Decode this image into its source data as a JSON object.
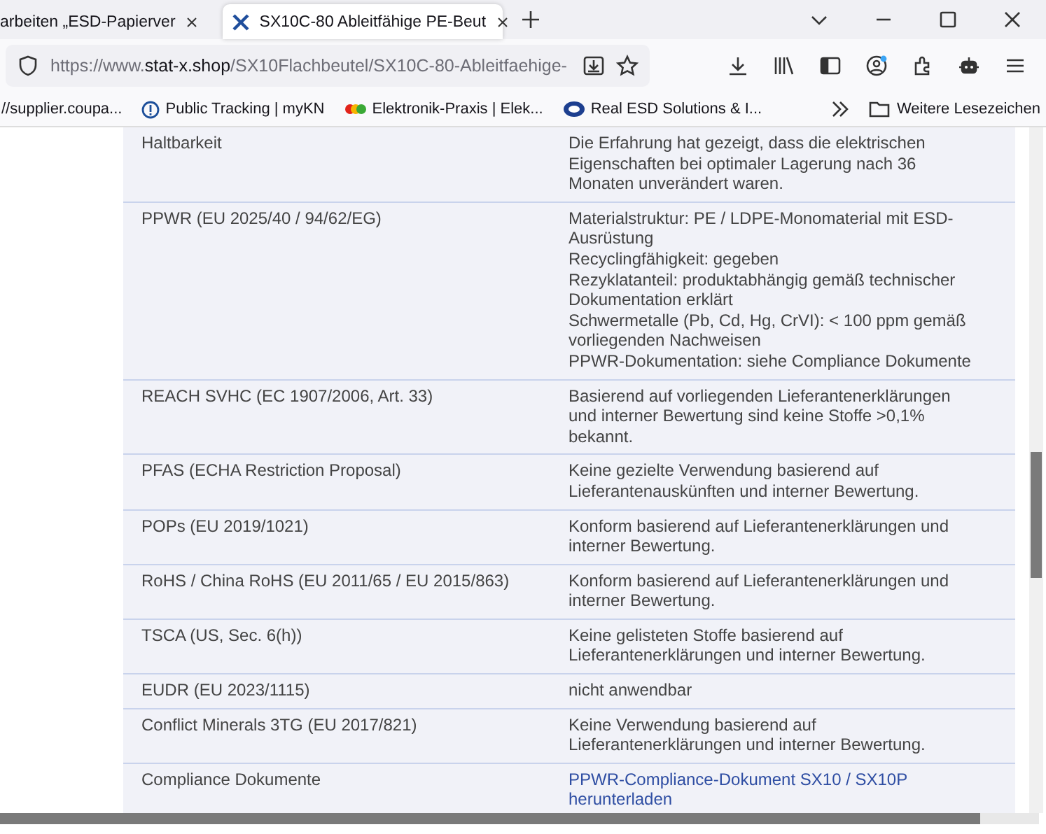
{
  "tabs": [
    {
      "title": "arbeiten „ESD-Papierver",
      "selected": false
    },
    {
      "title": "SX10C-80 Ableitfähige PE-Beut",
      "selected": true
    }
  ],
  "address": {
    "scheme": "https://www.",
    "host": "stat-x.shop",
    "path": "/SX10Flachbeutel/SX10C-80-Ableitfaehige-"
  },
  "bookmarks": [
    {
      "label": "//supplier.coupa...",
      "kind": "plain"
    },
    {
      "label": "Public Tracking | myKN",
      "kind": "info"
    },
    {
      "label": "Elektronik-Praxis | Elek...",
      "kind": "dots"
    },
    {
      "label": "Real ESD Solutions & I...",
      "kind": "sd"
    }
  ],
  "more_bookmarks": "Weitere Lesezeichen",
  "table": {
    "rows": [
      {
        "label": "Haltbarkeit",
        "kind": "text",
        "value": [
          "Die Erfahrung hat gezeigt, dass die elektrischen Eigenschaften bei optimaler Lagerung nach 36 Monaten unverändert waren."
        ]
      },
      {
        "label": "PPWR (EU 2025/40 / 94/62/EG)",
        "kind": "text",
        "value": [
          "Materialstruktur: PE / LDPE-Monomaterial mit ESD-Ausrüstung",
          "Recyclingfähigkeit: gegeben",
          "Rezyklatanteil: produktabhängig gemäß technischer Dokumentation erklärt",
          "Schwermetalle (Pb, Cd, Hg, CrVI): < 100 ppm gemäß vorliegenden Nachweisen",
          "PPWR-Dokumentation: siehe Compliance Dokumente"
        ]
      },
      {
        "label": "REACH SVHC (EC 1907/2006, Art. 33)",
        "kind": "text",
        "value": [
          "Basierend auf vorliegenden Lieferantenerklärungen und interner Bewertung sind keine Stoffe >0,1% bekannt."
        ]
      },
      {
        "label": "PFAS (ECHA Restriction Proposal)",
        "kind": "text",
        "value": [
          "Keine gezielte Verwendung basierend auf Lieferantenauskünften und interner Bewertung."
        ]
      },
      {
        "label": "POPs (EU 2019/1021)",
        "kind": "text",
        "value": [
          "Konform basierend auf Lieferantenerklärungen und interner Bewertung."
        ]
      },
      {
        "label": "RoHS / China RoHS (EU 2011/65 / EU 2015/863)",
        "kind": "text",
        "value": [
          "Konform basierend auf Lieferantenerklärungen und interner Bewertung."
        ]
      },
      {
        "label": "TSCA (US, Sec. 6(h))",
        "kind": "text",
        "value": [
          "Keine gelisteten Stoffe basierend auf Lieferantenerklärungen und interner Bewertung."
        ]
      },
      {
        "label": "EUDR (EU 2023/1115)",
        "kind": "text",
        "value": [
          "nicht anwendbar"
        ]
      },
      {
        "label": "Conflict Minerals 3TG (EU 2017/821)",
        "kind": "text",
        "value": [
          "Keine Verwendung basierend auf Lieferantenerklärungen und interner Bewertung."
        ]
      },
      {
        "label": "Compliance Dokumente",
        "kind": "link",
        "value": [
          "PPWR-Compliance-Dokument SX10 / SX10P herunterladen"
        ]
      }
    ]
  }
}
